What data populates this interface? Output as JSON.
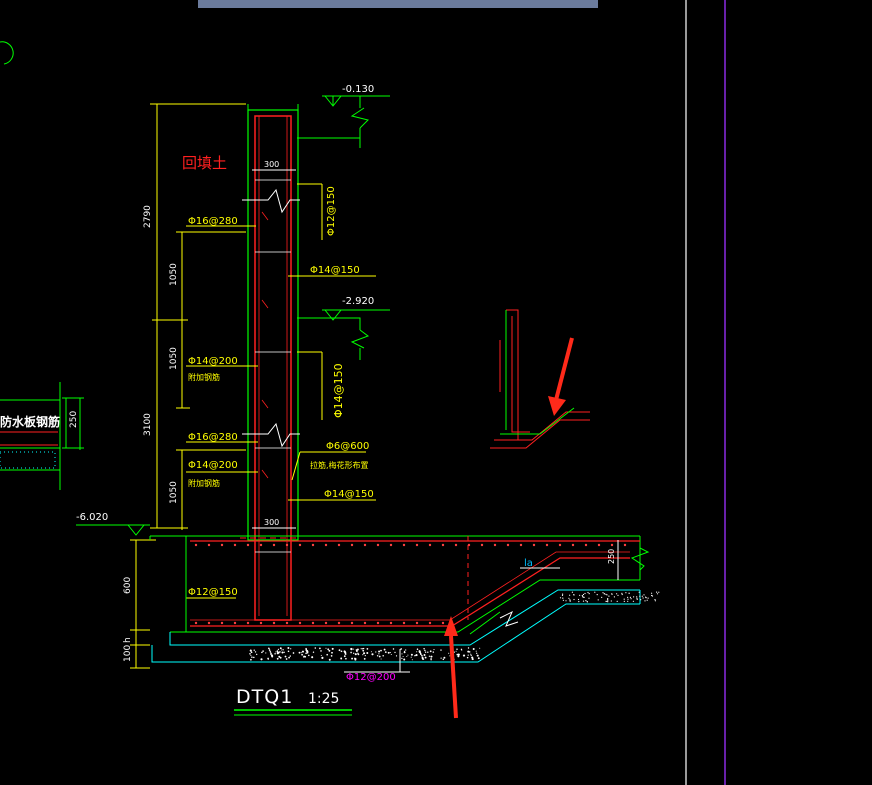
{
  "colors": {
    "background": "#000000",
    "concrete_outline": "#00ff00",
    "rebar": "#ff2020",
    "dimension": "#ffff00",
    "annotation": "#ffffff",
    "bedding": "#00ffff",
    "magenta": "#ff00ff",
    "frame_bar": "#6b7b9c",
    "frame_white": "#ffffff",
    "frame_purple": "#8a2be2",
    "arrow": "#ff2a1a"
  },
  "drawing": {
    "title": "DTQ1",
    "scale": "1:25",
    "backfill_label": "回填土",
    "waterproof_label": "防水板钢筋",
    "elevations": {
      "top": "-0.130",
      "mid": "-2.920",
      "bottom": "-6.020"
    },
    "dimensions": {
      "upper_height": "2790",
      "lower_height": "3100",
      "seg_1050_a": "1050",
      "seg_1050_b": "1050",
      "seg_1050_c": "1050",
      "wall_width_top": "300",
      "wall_width_bottom": "300",
      "base_600": "600",
      "base_100": "100",
      "base_h": "h",
      "slab_250": "250",
      "right_250": "250",
      "la": "la"
    },
    "rebar_labels": {
      "r1": "Φ16@280",
      "r2": "Φ12@150",
      "r3": "Φ14@150",
      "r4": "Φ14@200",
      "r4_sub": "附加钢筋",
      "r5": "Φ14@150",
      "r6": "Φ16@280",
      "r7": "Φ6@600",
      "r7_sub": "拉筋,梅花形布置",
      "r8": "Φ14@200",
      "r8_sub": "附加钢筋",
      "r9": "Φ14@150",
      "r10": "Φ12@150",
      "r11": "Φ12@200"
    }
  }
}
